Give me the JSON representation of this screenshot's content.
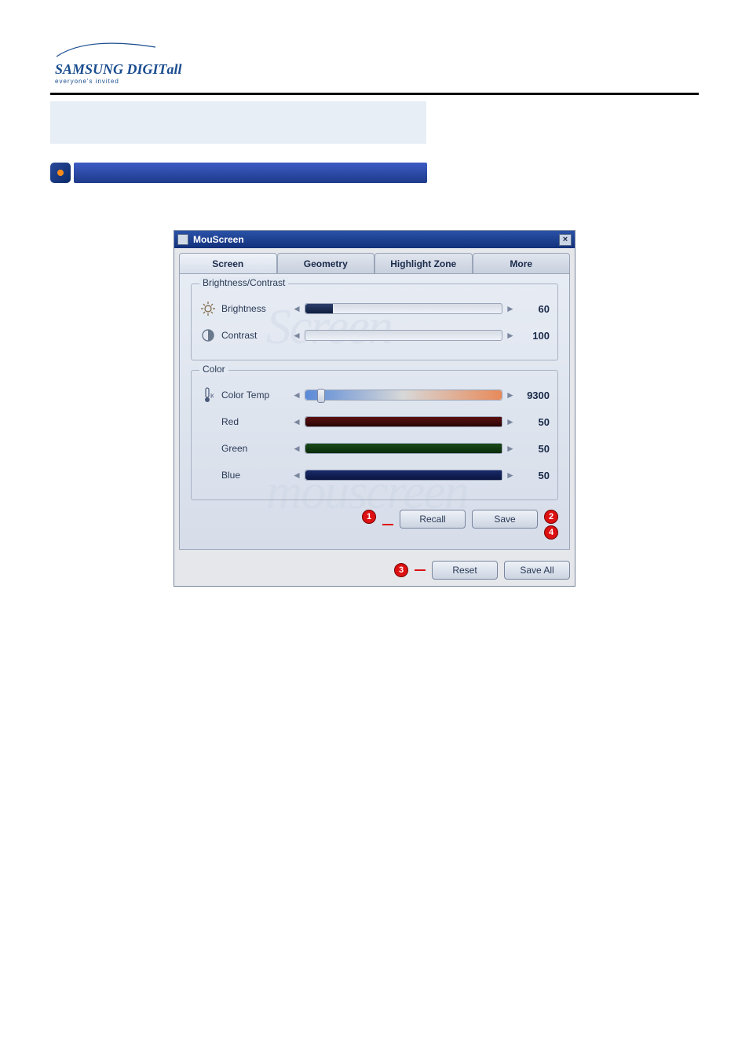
{
  "logo": {
    "brand_a": "SAMSUNG",
    "brand_b": "DIGIT",
    "brand_c": "all",
    "tagline": "everyone's invited"
  },
  "window": {
    "title": "MouScreen",
    "close_x": "×"
  },
  "tabs": [
    {
      "label": "Screen"
    },
    {
      "label": "Geometry"
    },
    {
      "label": "Highlight Zone"
    },
    {
      "label": "More"
    }
  ],
  "groups": {
    "bc": {
      "title": "Brightness/Contrast",
      "brightness": {
        "label": "Brightness",
        "value": "60",
        "pct": 14
      },
      "contrast": {
        "label": "Contrast",
        "value": "100",
        "pct": 100
      }
    },
    "color": {
      "title": "Color",
      "colortemp": {
        "label": "Color Temp",
        "value": "9300",
        "thumb_pct": 6
      },
      "red": {
        "label": "Red",
        "value": "50",
        "pct": 100
      },
      "green": {
        "label": "Green",
        "value": "50",
        "pct": 100
      },
      "blue": {
        "label": "Blue",
        "value": "50",
        "pct": 100
      }
    }
  },
  "buttons": {
    "recall": "Recall",
    "save": "Save",
    "reset": "Reset",
    "save_all": "Save All"
  },
  "badges": {
    "b1": "1",
    "b2": "2",
    "b3": "3",
    "b4": "4"
  },
  "watermark": "Screen",
  "watermark2": "mouscreen"
}
